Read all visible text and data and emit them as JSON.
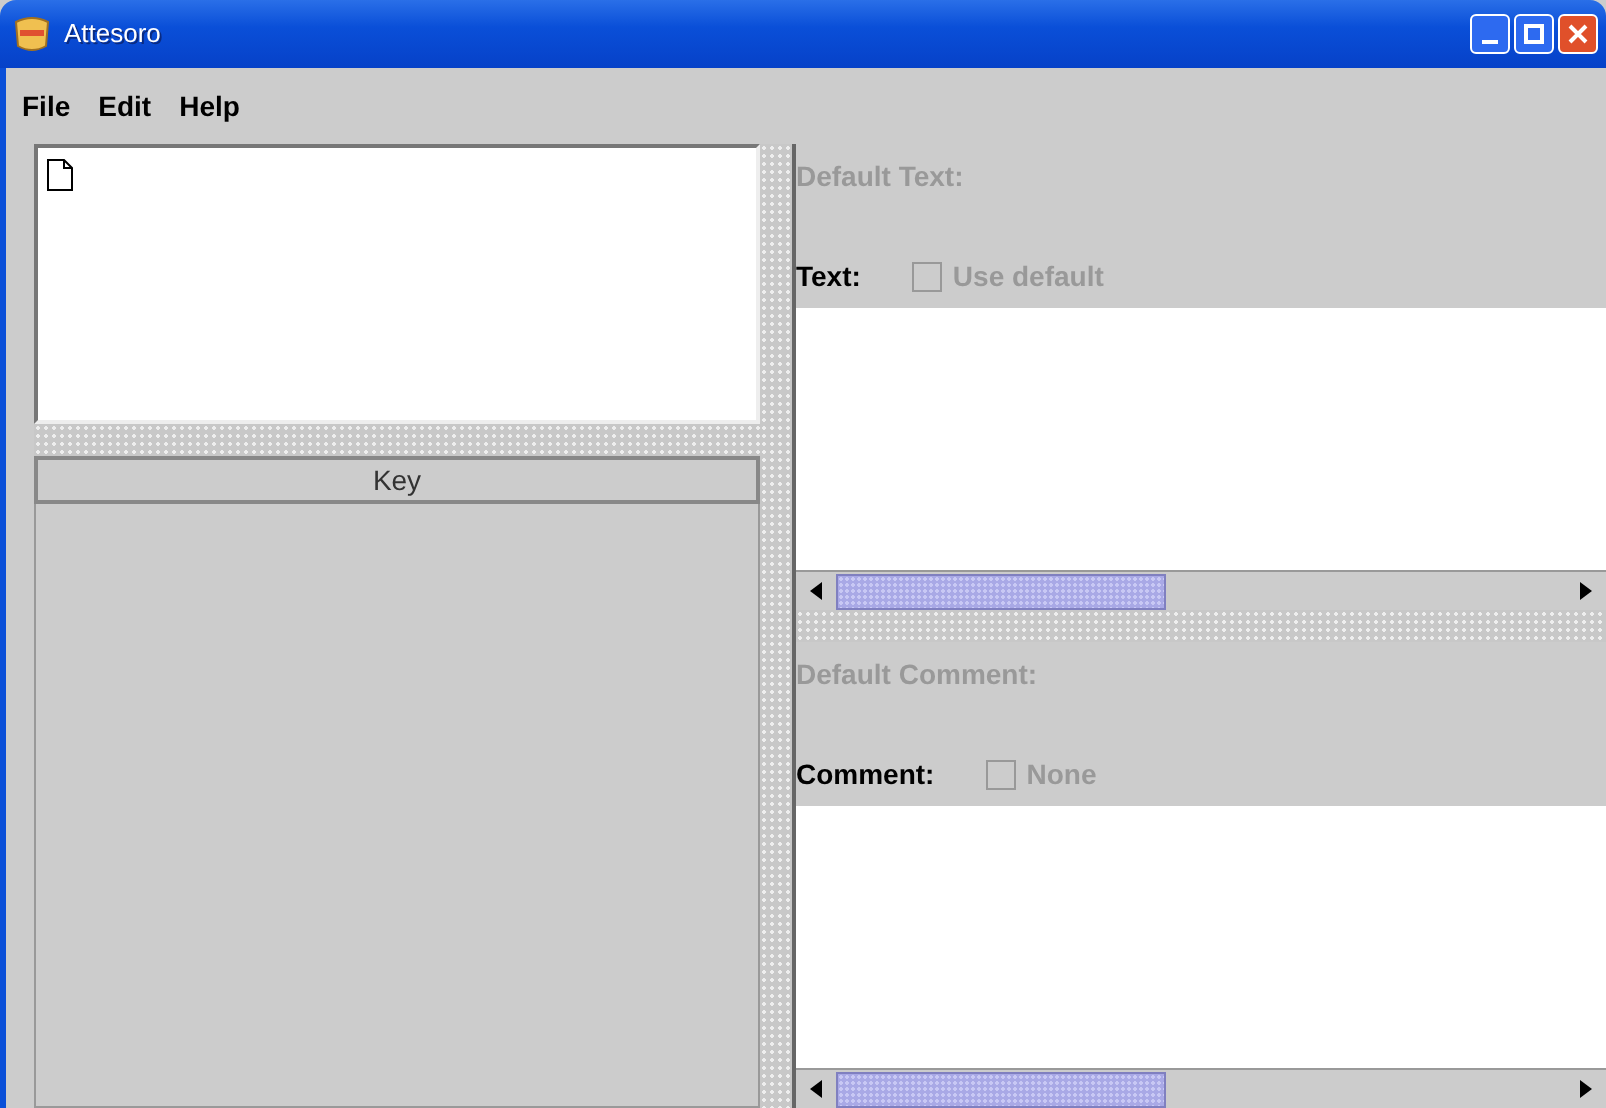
{
  "window": {
    "title": "Attesoro"
  },
  "menu": [
    {
      "label": "File"
    },
    {
      "label": "Edit"
    },
    {
      "label": "Help"
    }
  ],
  "key_column": {
    "label": "Key"
  },
  "sections": [
    {
      "default_label": "Default Text:",
      "field_label": "Text:",
      "checkbox": {
        "label": "Use default",
        "checked": false,
        "disabled": true
      }
    },
    {
      "default_label": "Default Comment:",
      "field_label": "Comment:",
      "checkbox": {
        "label": "None",
        "checked": false,
        "disabled": true
      }
    }
  ]
}
